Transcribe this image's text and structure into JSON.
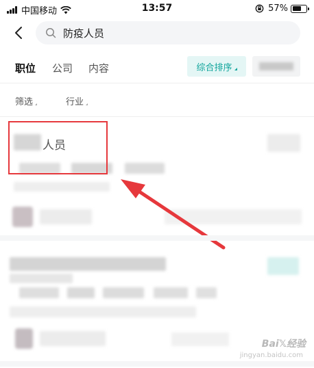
{
  "status_bar": {
    "carrier": "中国移动",
    "time": "13:57",
    "battery": "57%",
    "battery_level": 0.57
  },
  "search": {
    "query": "防疫人员"
  },
  "tabs": [
    {
      "label": "职位",
      "active": true
    },
    {
      "label": "公司",
      "active": false
    },
    {
      "label": "内容",
      "active": false
    }
  ],
  "sort": {
    "label": "综合排序"
  },
  "filters": [
    {
      "label": "筛选"
    },
    {
      "label": "行业"
    }
  ],
  "result_card": {
    "title": "人员"
  },
  "watermark": {
    "text": "Bai𝕏经验",
    "sub": "jingyan.baidu.com"
  },
  "colors": {
    "accent": "#11a59c",
    "highlight": "#e6383c",
    "arrow": "#e6383c"
  }
}
